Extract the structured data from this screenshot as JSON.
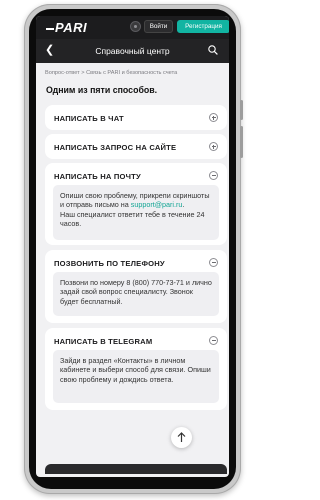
{
  "header": {
    "logo": "PARI",
    "login_label": "Войти",
    "register_label": "Регистрация"
  },
  "nav": {
    "title": "Справочный центр",
    "back_icon": "back-arrow-icon",
    "search_icon": "search-icon"
  },
  "breadcrumbs": "Вопрос-ответ  >  Связь с PARI и безопасность счета",
  "heading": "Одним из пяти способов.",
  "sections": [
    {
      "title": "НАПИСАТЬ В ЧАТ",
      "state": "collapsed"
    },
    {
      "title": "НАПИСАТЬ ЗАПРОС НА САЙТЕ",
      "state": "collapsed"
    },
    {
      "title": "НАПИСАТЬ НА ПОЧТУ",
      "state": "expanded",
      "body_1": "Опиши свою проблему, прикрепи скриншоты и отправь письмо на",
      "email": "support@pari.ru",
      "body_2": ".",
      "body_3": "Наш специалист ответит тебе в течение 24 часов."
    },
    {
      "title": "ПОЗВОНИТЬ ПО ТЕЛЕФОНУ",
      "state": "expanded",
      "body_1": "Позвони по номеру 8 (800) 770-73-71 и лично задай свой вопрос специалисту. Звонок будет бесплатный."
    },
    {
      "title": "НАПИСАТЬ В TELEGRAM",
      "state": "expanded",
      "body_1": "Зайди в раздел «Контакты» в личном кабинете и выбери способ для связи. Опиши свою проблему и дождись ответа."
    }
  ],
  "colors": {
    "accent": "#12b4a2",
    "link": "#12a594",
    "header_bg": "#1c1c1e"
  }
}
